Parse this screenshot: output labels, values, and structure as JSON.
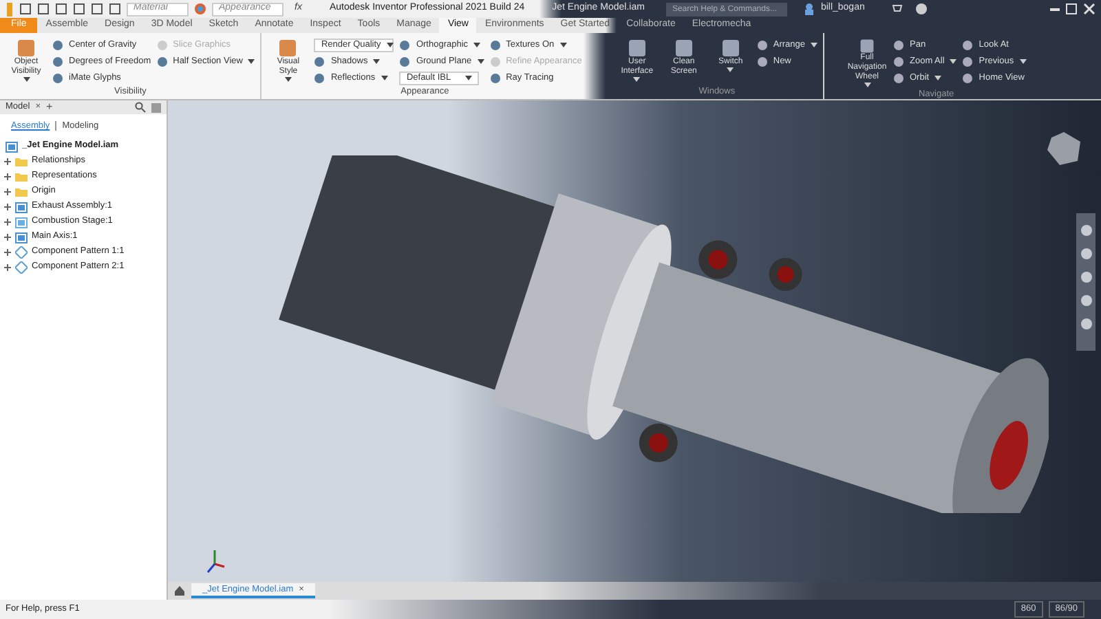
{
  "title_bar": {
    "material_placeholder": "Material",
    "appearance_placeholder": "Appearance",
    "formula": "fx",
    "title": "Autodesk Inventor Professional 2021 Build 24",
    "document": "Jet Engine Model.iam",
    "search_placeholder": "Search Help & Commands...",
    "user": "bill_bogan"
  },
  "tabs": [
    {
      "label": "File",
      "selected": false,
      "kind": "file"
    },
    {
      "label": "Assemble",
      "selected": false,
      "kind": "tab"
    },
    {
      "label": "Design",
      "selected": false,
      "kind": "tab"
    },
    {
      "label": "3D Model",
      "selected": false,
      "kind": "tab"
    },
    {
      "label": "Sketch",
      "selected": false,
      "kind": "tab"
    },
    {
      "label": "Annotate",
      "selected": false,
      "kind": "tab"
    },
    {
      "label": "Inspect",
      "selected": false,
      "kind": "tab"
    },
    {
      "label": "Tools",
      "selected": false,
      "kind": "tab"
    },
    {
      "label": "Manage",
      "selected": false,
      "kind": "tab"
    },
    {
      "label": "View",
      "selected": true,
      "kind": "tab"
    },
    {
      "label": "Environments",
      "selected": false,
      "kind": "tab"
    },
    {
      "label": "Get Started",
      "selected": false,
      "kind": "tab"
    },
    {
      "label": "Collaborate",
      "selected": false,
      "kind": "tab"
    },
    {
      "label": "Electromecha",
      "selected": false,
      "kind": "tab"
    }
  ],
  "ribbon": [
    {
      "title": "Visibility",
      "large": [
        {
          "label": "Object Visibility",
          "dropdown": true
        }
      ],
      "columns": [
        [
          {
            "label": "Center of Gravity",
            "kind": "button",
            "disabled": false,
            "dropdown": false
          },
          {
            "label": "Degrees of Freedom",
            "kind": "button",
            "disabled": false,
            "dropdown": false
          },
          {
            "label": "iMate Glyphs",
            "kind": "button",
            "disabled": false,
            "dropdown": false
          }
        ],
        [
          {
            "label": "Slice Graphics",
            "kind": "button",
            "disabled": true,
            "dropdown": false
          },
          {
            "label": "Half Section View",
            "kind": "button",
            "disabled": false,
            "dropdown": true
          }
        ]
      ]
    },
    {
      "title": "Appearance",
      "large": [
        {
          "label": "Visual Style",
          "dropdown": true
        }
      ],
      "columns": [
        [
          {
            "label": "Render Quality",
            "kind": "combo",
            "disabled": false,
            "dropdown": true
          },
          {
            "label": "Shadows",
            "kind": "button",
            "disabled": false,
            "dropdown": true
          },
          {
            "label": "Reflections",
            "kind": "button",
            "disabled": false,
            "dropdown": true
          }
        ],
        [
          {
            "label": "Orthographic",
            "kind": "button",
            "disabled": false,
            "dropdown": true
          },
          {
            "label": "Ground Plane",
            "kind": "button",
            "disabled": false,
            "dropdown": true
          },
          {
            "label": "Default IBL",
            "kind": "combo",
            "disabled": false,
            "dropdown": true
          }
        ],
        [
          {
            "label": "Textures On",
            "kind": "button",
            "disabled": false,
            "dropdown": true
          },
          {
            "label": "Refine Appearance",
            "kind": "button",
            "disabled": true,
            "dropdown": false
          },
          {
            "label": "Ray Tracing",
            "kind": "button",
            "disabled": false,
            "dropdown": false
          }
        ]
      ]
    },
    {
      "title": "Windows",
      "large": [
        {
          "label": "User Interface",
          "dropdown": true
        },
        {
          "label": "Clean Screen",
          "dropdown": false
        },
        {
          "label": "Switch",
          "dropdown": true
        }
      ],
      "columns": [
        [
          {
            "label": "Arrange",
            "kind": "button",
            "disabled": false,
            "dropdown": true
          },
          {
            "label": "New",
            "kind": "button",
            "disabled": false,
            "dropdown": false
          }
        ]
      ]
    },
    {
      "title": "Navigate",
      "large": [
        {
          "label": "Full Navigation Wheel",
          "dropdown": true
        }
      ],
      "columns": [
        [
          {
            "label": "Pan",
            "kind": "button",
            "disabled": false,
            "dropdown": false
          },
          {
            "label": "Zoom All",
            "kind": "button",
            "disabled": false,
            "dropdown": true
          },
          {
            "label": "Orbit",
            "kind": "button",
            "disabled": false,
            "dropdown": true
          }
        ],
        [
          {
            "label": "Look At",
            "kind": "button",
            "disabled": false,
            "dropdown": false
          },
          {
            "label": "Previous",
            "kind": "button",
            "disabled": false,
            "dropdown": true
          },
          {
            "label": "Home View",
            "kind": "button",
            "disabled": false,
            "dropdown": false
          }
        ]
      ]
    }
  ],
  "browser": {
    "tab": "Model",
    "close": "×",
    "add": "+",
    "subtabs": [
      {
        "label": "Assembly",
        "selected": true
      },
      {
        "label": "Modeling",
        "selected": false
      }
    ],
    "tree": [
      {
        "label": "_Jet Engine Model.iam",
        "kind": "assembly",
        "children": [
          {
            "label": "Relationships",
            "kind": "folder",
            "expanded": false
          },
          {
            "label": "Representations",
            "kind": "folder",
            "expanded": false
          },
          {
            "label": "Origin",
            "kind": "folder",
            "expanded": false
          },
          {
            "label": "Exhaust Assembly:1",
            "kind": "assembly",
            "expanded": false
          },
          {
            "label": "Combustion Stage:1",
            "kind": "part",
            "expanded": false
          },
          {
            "label": "Main Axis:1",
            "kind": "assembly",
            "expanded": false
          },
          {
            "label": "Component Pattern 1:1",
            "kind": "pattern",
            "expanded": false
          },
          {
            "label": "Component Pattern 2:1",
            "kind": "pattern",
            "expanded": false
          }
        ]
      }
    ]
  },
  "document_tabs": [
    {
      "label": "_Jet Engine Model.iam",
      "selected": true,
      "close": "×"
    }
  ],
  "status_bar": {
    "help": "For Help, press F1",
    "count_1": "860",
    "count_2": "86/90"
  }
}
